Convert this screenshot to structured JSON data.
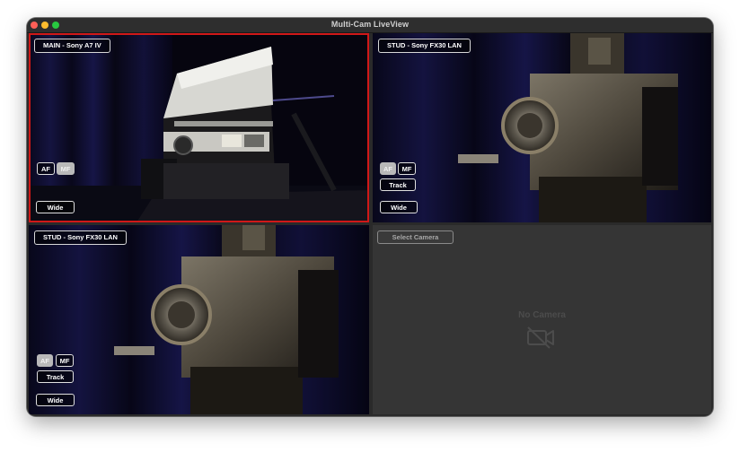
{
  "window": {
    "title": "Multi-Cam LiveView"
  },
  "panes": [
    {
      "label": "MAIN - Sony A7 IV",
      "selected": true,
      "af_label": "AF",
      "mf_label": "MF",
      "focus_mode": "MF",
      "zoom_label": "Wide"
    },
    {
      "label": "STUD - Sony FX30 LAN",
      "selected": false,
      "af_label": "AF",
      "mf_label": "MF",
      "focus_mode": "AF",
      "track_label": "Track",
      "zoom_label": "Wide"
    },
    {
      "label": "STUD - Sony FX30 LAN",
      "selected": false,
      "af_label": "AF",
      "mf_label": "MF",
      "focus_mode": "AF",
      "track_label": "Track",
      "zoom_label": "Wide"
    },
    {
      "select_label": "Select Camera",
      "empty_text": "No Camera",
      "empty_icon": "video-slash-icon"
    }
  ],
  "colors": {
    "selection": "#d01818",
    "window_bg": "#2a2a2a"
  }
}
